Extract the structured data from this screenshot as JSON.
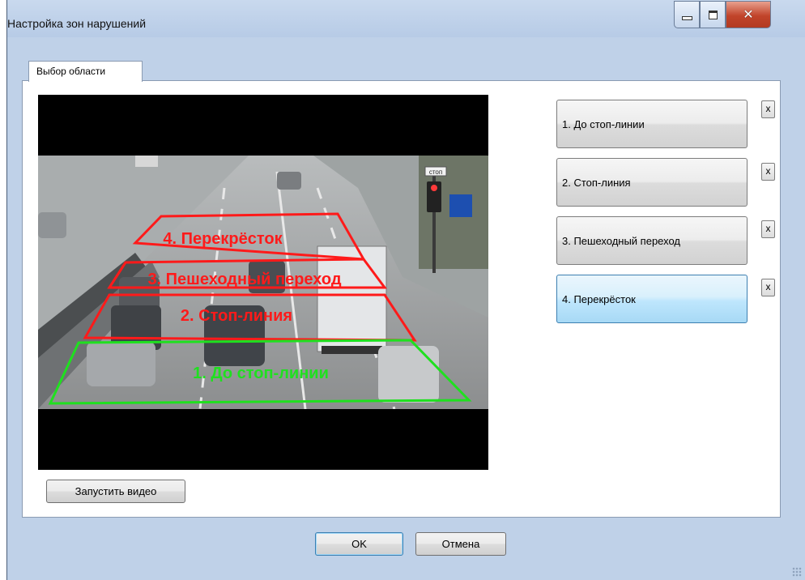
{
  "window": {
    "title": "Настройка зон нарушений"
  },
  "tab": {
    "label": "Выбор области"
  },
  "video": {
    "zone_labels": [
      "4. Перекрёсток",
      "3. Пешеходный переход",
      "2. Стоп-линия",
      "1. До стоп-линии"
    ],
    "zone_colors": {
      "red": "#ff1a1a",
      "green": "#1fe01f"
    },
    "sign_text": "стоп"
  },
  "zones": [
    {
      "label": "1. До стоп-линии",
      "delete_label": "x",
      "active": false
    },
    {
      "label": "2. Стоп-линия",
      "delete_label": "x",
      "active": false
    },
    {
      "label": "3. Пешеходный переход",
      "delete_label": "x",
      "active": false
    },
    {
      "label": "4. Перекрёсток",
      "delete_label": "x",
      "active": true
    }
  ],
  "buttons": {
    "start_video": "Запустить видео",
    "ok": "OK",
    "cancel": "Отмена"
  },
  "colors": {
    "window_bg": "#bfd1e8",
    "active_button": "#bee6fd",
    "close_button": "#c1442a"
  }
}
